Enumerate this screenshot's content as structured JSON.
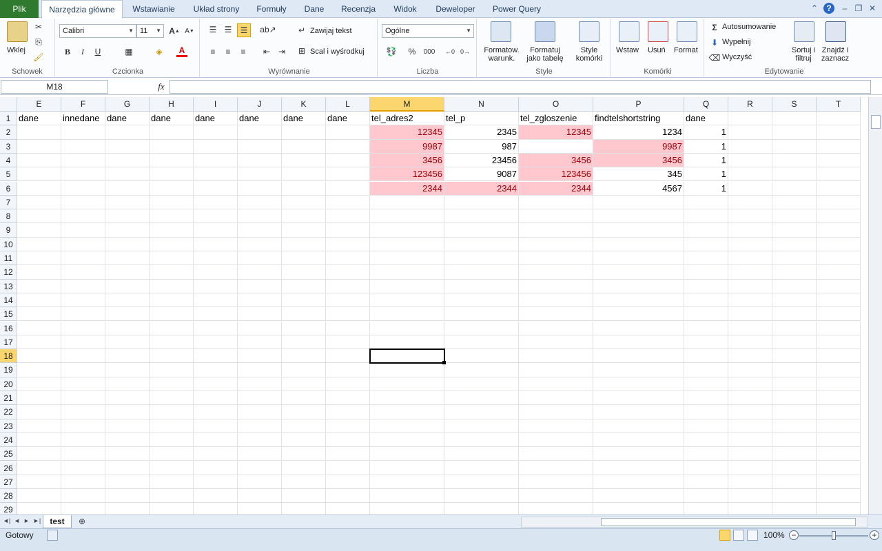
{
  "ribbon_tabs": [
    "Plik",
    "Narzędzia główne",
    "Wstawianie",
    "Układ strony",
    "Formuły",
    "Dane",
    "Recenzja",
    "Widok",
    "Deweloper",
    "Power Query"
  ],
  "groups": {
    "clipboard": {
      "label": "Schowek",
      "paste": "Wklej"
    },
    "font": {
      "label": "Czcionka",
      "name": "Calibri",
      "size": "11",
      "bold": "B",
      "italic": "I",
      "underline": "U"
    },
    "alignment": {
      "label": "Wyrównanie",
      "wrap": "Zawijaj tekst",
      "merge": "Scal i wyśrodkuj"
    },
    "number": {
      "label": "Liczba",
      "format": "Ogólne",
      "percent": "%",
      "thousands": "000"
    },
    "styles": {
      "label": "Style",
      "cond_format": "Formatow. warunk.",
      "as_table": "Formatuj jako tabelę",
      "cell_styles": "Style komórki"
    },
    "cells": {
      "label": "Komórki",
      "insert": "Wstaw",
      "delete": "Usuń",
      "format": "Format"
    },
    "editing": {
      "label": "Edytowanie",
      "autosum": "Autosumowanie",
      "fill": "Wypełnij",
      "clear": "Wyczyść",
      "sort": "Sortuj i filtruj",
      "find": "Znajdź i zaznacz"
    }
  },
  "formula_bar": {
    "name_box": "M18",
    "fx": "fx",
    "formula": ""
  },
  "grid": {
    "columns": [
      "E",
      "F",
      "G",
      "H",
      "I",
      "J",
      "K",
      "L",
      "M",
      "N",
      "O",
      "P",
      "Q",
      "R",
      "S",
      "T"
    ],
    "selected_column": "M",
    "selected_row": 18,
    "rows_visible": 29,
    "header_row": [
      "dane",
      "innedane",
      "dane",
      "dane",
      "dane",
      "dane",
      "dane",
      "dane",
      "tel_adres2",
      "tel_p",
      "tel_zgloszenie",
      "findtelshortstring",
      "dane",
      "",
      "",
      ""
    ],
    "data": {
      "M": [
        "12345",
        "9987",
        "3456",
        "123456",
        "2344"
      ],
      "N": [
        "2345",
        "987",
        "23456",
        "9087",
        "2344"
      ],
      "O": [
        "12345",
        "",
        "3456",
        "123456",
        "2344"
      ],
      "P": [
        "1234",
        "9987",
        "3456",
        "345",
        "4567"
      ],
      "Q": [
        "1",
        "1",
        "1",
        "1",
        "1"
      ]
    },
    "highlight": {
      "M": [
        true,
        true,
        true,
        true,
        true
      ],
      "N": [
        false,
        false,
        false,
        false,
        true
      ],
      "O": [
        true,
        false,
        true,
        true,
        true
      ],
      "P": [
        false,
        true,
        true,
        false,
        false
      ],
      "Q": [
        false,
        false,
        false,
        false,
        false
      ]
    },
    "highlight_colors": {
      "fill": "#ffc7ce",
      "text": "#9c0006"
    }
  },
  "sheet_tabs": [
    "test"
  ],
  "status": {
    "ready": "Gotowy",
    "zoom": "100%"
  }
}
